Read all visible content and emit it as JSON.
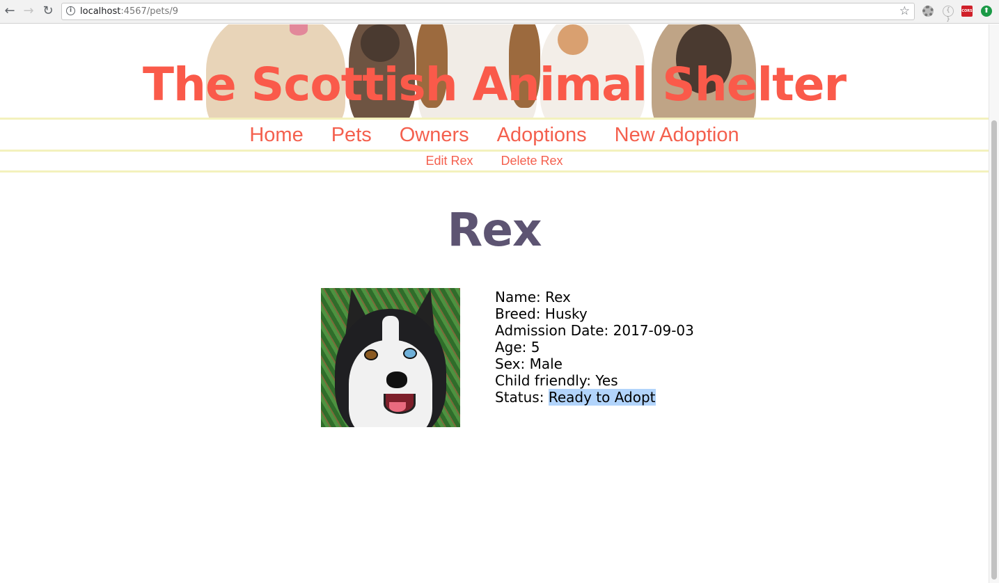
{
  "browser": {
    "url_host": "localhost",
    "url_path": ":4567/pets/9",
    "info_icon_glyph": "i",
    "extensions": [
      {
        "icon": "gear-icon"
      },
      {
        "icon": "bracket-icon",
        "glyph": "{ }"
      },
      {
        "icon": "cors-icon",
        "glyph": "CORS"
      },
      {
        "icon": "upload-icon",
        "glyph": "⬆"
      }
    ]
  },
  "site": {
    "title": "The Scottish Animal Shelter"
  },
  "nav": {
    "items": [
      {
        "label": "Home"
      },
      {
        "label": "Pets"
      },
      {
        "label": "Owners"
      },
      {
        "label": "Adoptions"
      },
      {
        "label": "New Adoption"
      }
    ]
  },
  "subnav": {
    "edit_label": "Edit Rex",
    "delete_label": "Delete Rex"
  },
  "pet": {
    "name": "Rex",
    "photo_alt": "Husky",
    "details": [
      {
        "label": "Name:",
        "value": "Rex"
      },
      {
        "label": "Breed:",
        "value": "Husky"
      },
      {
        "label": "Admission Date:",
        "value": "2017-09-03"
      },
      {
        "label": "Age:",
        "value": "5"
      },
      {
        "label": "Sex:",
        "value": "Male"
      },
      {
        "label": "Child friendly:",
        "value": "Yes"
      },
      {
        "label": "Status:",
        "value": "Ready to Adopt"
      }
    ]
  },
  "colors": {
    "accent": "#fa5a4a",
    "heading": "#5d5472",
    "rule": "#f3f1bd",
    "selection": "#b2d4fb"
  }
}
